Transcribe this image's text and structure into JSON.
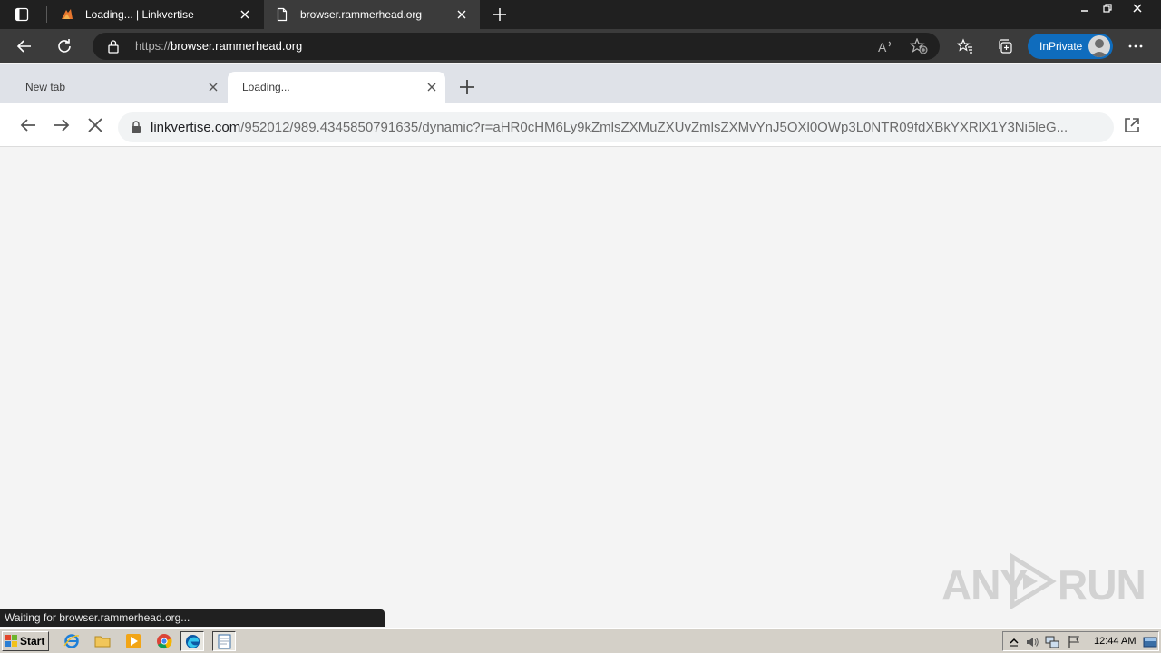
{
  "edge": {
    "tabs": [
      {
        "title": "Loading... | Linkvertise",
        "active": false
      },
      {
        "title": "browser.rammerhead.org",
        "active": true
      }
    ],
    "address": {
      "scheme": "https://",
      "host": "browser.rammerhead.org"
    },
    "inprivate_label": "InPrivate"
  },
  "inner": {
    "tabs": [
      {
        "title": "New tab",
        "active": false
      },
      {
        "title": "Loading...",
        "active": true
      }
    ],
    "address": {
      "host": "linkvertise.com",
      "path": "/952012/989.4345850791635/dynamic?r=aHR0cHM6Ly9kZmlsZXMuZXUvZmlsZXMvYnJ5OXl0OWp3L0NTR09fdXBkYXRlX1Y3Ni5leG..."
    }
  },
  "status": {
    "text": "Waiting for browser.rammerhead.org..."
  },
  "watermark": {
    "left": "ANY",
    "right": "RUN"
  },
  "taskbar": {
    "start_label": "Start",
    "clock": "12:44 AM"
  },
  "colors": {
    "edge_dark": "#202020",
    "edge_toolbar": "#3b3b3b",
    "inprivate": "#0f6cbd",
    "page_bg": "#f4f4f4"
  },
  "icons": [
    "tab-actions-icon",
    "linkvertise-favicon",
    "page-favicon",
    "close-icon",
    "plus-icon",
    "back-icon",
    "reload-icon",
    "lock-icon",
    "read-aloud-icon",
    "add-favorite-icon",
    "favorites-icon",
    "collections-icon",
    "more-icon",
    "forward-icon",
    "stop-icon",
    "popout-icon",
    "windows-logo-icon",
    "ie-icon",
    "explorer-icon",
    "media-player-icon",
    "chrome-icon",
    "edge-icon",
    "notepad-icon",
    "volume-icon",
    "network-icon",
    "flag-icon",
    "show-desktop-icon"
  ]
}
